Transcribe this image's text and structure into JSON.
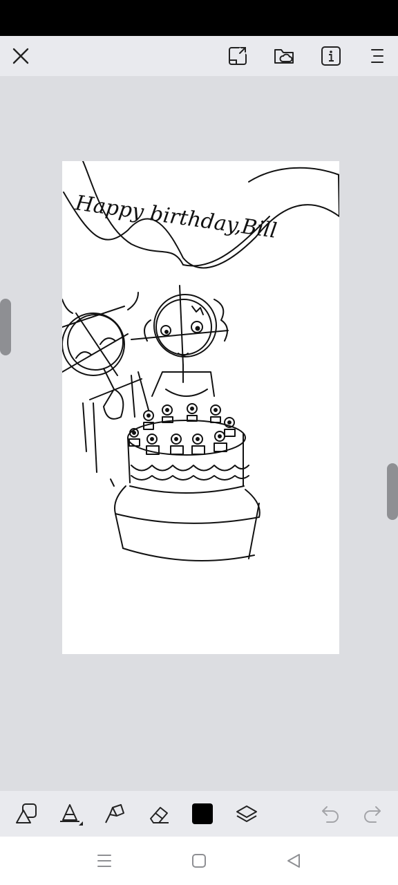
{
  "toolbar_top": {
    "icons": [
      "close-icon",
      "share-icon",
      "folder-cloud-icon",
      "info-icon",
      "menu-icon"
    ]
  },
  "canvas": {
    "banner_text": "Happy birthday,Bill"
  },
  "tools": [
    "shape-icon",
    "pencil-icon",
    "fill-icon",
    "eraser-icon",
    "color-swatch",
    "layers-icon",
    "undo-icon",
    "redo-icon"
  ],
  "colors": {
    "current_color": "#000000",
    "toolbar_bg": "#e9eaee",
    "workspace_bg": "#dcdde1"
  },
  "nav": [
    "recents-icon",
    "home-icon",
    "back-icon"
  ]
}
